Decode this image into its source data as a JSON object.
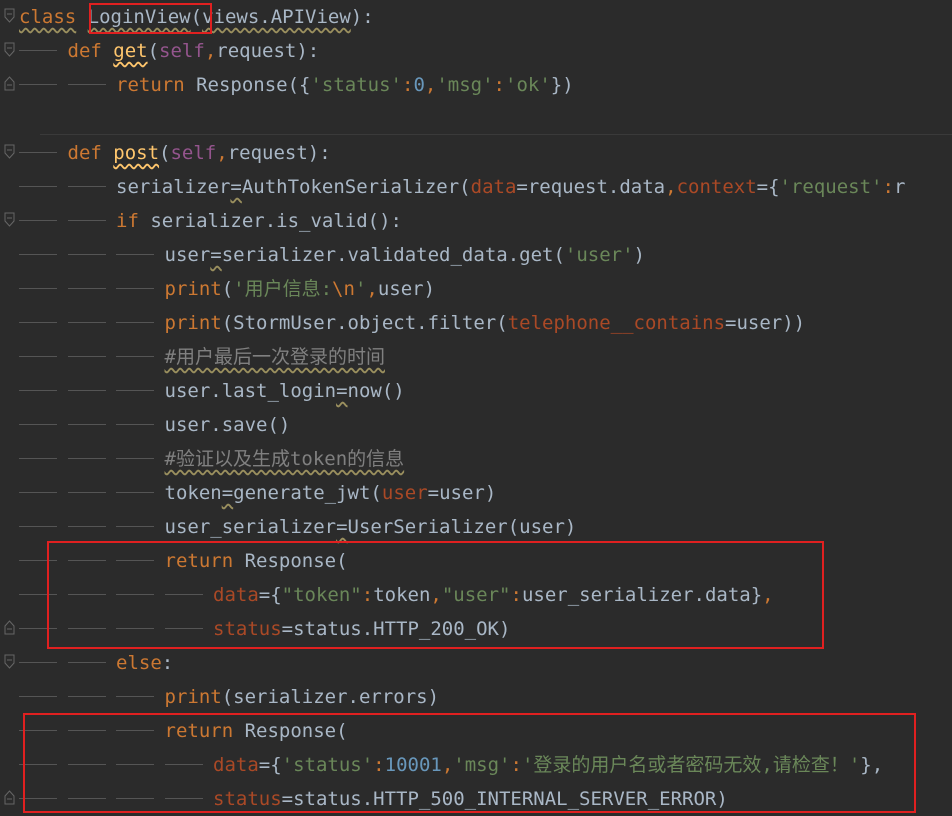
{
  "lines": [
    {
      "indent": 0,
      "fold": "start",
      "parts": [
        {
          "t": "class",
          "c": "kw warn"
        },
        {
          "t": " "
        },
        {
          "t": "LoginView",
          "c": "warn"
        },
        {
          "t": "("
        },
        {
          "t": "views.APIView",
          "c": "warn"
        },
        {
          "t": "):"
        }
      ]
    },
    {
      "indent": 1,
      "fold": "start",
      "parts": [
        {
          "t": "def ",
          "c": "kw"
        },
        {
          "t": "get",
          "c": "fn"
        },
        {
          "t": "("
        },
        {
          "t": "self",
          "c": "self"
        },
        {
          "t": ",",
          "c": "kw"
        },
        {
          "t": "request):"
        }
      ]
    },
    {
      "indent": 2,
      "fold": "end",
      "parts": [
        {
          "t": "return ",
          "c": "kw"
        },
        {
          "t": "Response({"
        },
        {
          "t": "'status'",
          "c": "str"
        },
        {
          "t": ":",
          "c": "kw"
        },
        {
          "t": "0",
          "c": "num"
        },
        {
          "t": ",",
          "c": "kw"
        },
        {
          "t": "'msg'",
          "c": "str"
        },
        {
          "t": ":",
          "c": "kw"
        },
        {
          "t": "'ok'",
          "c": "str"
        },
        {
          "t": "})"
        }
      ]
    },
    {
      "indent": 0,
      "parts": []
    },
    {
      "indent": 1,
      "fold": "start",
      "parts": [
        {
          "t": "def ",
          "c": "kw"
        },
        {
          "t": "post",
          "c": "fn"
        },
        {
          "t": "("
        },
        {
          "t": "self",
          "c": "self"
        },
        {
          "t": ",",
          "c": "kw"
        },
        {
          "t": "request):"
        }
      ]
    },
    {
      "indent": 2,
      "parts": [
        {
          "t": "serializer"
        },
        {
          "t": "=",
          "c": "warn"
        },
        {
          "t": "AuthTokenSerializer("
        },
        {
          "t": "data",
          "c": "param"
        },
        {
          "t": "=request.data"
        },
        {
          "t": ",",
          "c": "kw"
        },
        {
          "t": "context",
          "c": "param"
        },
        {
          "t": "={"
        },
        {
          "t": "'request'",
          "c": "str"
        },
        {
          "t": ":",
          "c": "kw"
        },
        {
          "t": "r"
        }
      ]
    },
    {
      "indent": 2,
      "fold": "start",
      "parts": [
        {
          "t": "if ",
          "c": "kw"
        },
        {
          "t": "serializer.is_valid():"
        }
      ]
    },
    {
      "indent": 3,
      "parts": [
        {
          "t": "user"
        },
        {
          "t": "=",
          "c": "warn"
        },
        {
          "t": "serializer.validated_data.get("
        },
        {
          "t": "'user'",
          "c": "str"
        },
        {
          "t": ")"
        }
      ]
    },
    {
      "indent": 3,
      "parts": [
        {
          "t": "print",
          "c": "kw"
        },
        {
          "t": "("
        },
        {
          "t": "'用户信息:",
          "c": "str"
        },
        {
          "t": "\\n",
          "c": "kw"
        },
        {
          "t": "'",
          "c": "str"
        },
        {
          "t": ",",
          "c": "kw"
        },
        {
          "t": "user)"
        }
      ]
    },
    {
      "indent": 3,
      "parts": [
        {
          "t": "print",
          "c": "kw"
        },
        {
          "t": "(StormUser.object.filter("
        },
        {
          "t": "telephone__contains",
          "c": "param"
        },
        {
          "t": "=user))"
        }
      ]
    },
    {
      "indent": 3,
      "parts": [
        {
          "t": "#用户最后一次登录的时间",
          "c": "cmt"
        }
      ]
    },
    {
      "indent": 3,
      "parts": [
        {
          "t": "user.last_login"
        },
        {
          "t": "=",
          "c": "warn"
        },
        {
          "t": "now()"
        }
      ]
    },
    {
      "indent": 3,
      "parts": [
        {
          "t": "user.save()"
        }
      ]
    },
    {
      "indent": 3,
      "parts": [
        {
          "t": "#验证以及生成token的信息",
          "c": "cmt"
        }
      ]
    },
    {
      "indent": 3,
      "parts": [
        {
          "t": "token"
        },
        {
          "t": "=",
          "c": "warn"
        },
        {
          "t": "generate_jwt("
        },
        {
          "t": "user",
          "c": "param"
        },
        {
          "t": "=user)"
        }
      ]
    },
    {
      "indent": 3,
      "parts": [
        {
          "t": "user_serializer"
        },
        {
          "t": "=",
          "c": "warn"
        },
        {
          "t": "UserSerializer(user)"
        }
      ]
    },
    {
      "indent": 3,
      "parts": [
        {
          "t": "return ",
          "c": "kw"
        },
        {
          "t": "Response("
        }
      ]
    },
    {
      "indent": 4,
      "parts": [
        {
          "t": "data",
          "c": "param"
        },
        {
          "t": "={"
        },
        {
          "t": "\"token\"",
          "c": "str"
        },
        {
          "t": ":",
          "c": "kw"
        },
        {
          "t": "token"
        },
        {
          "t": ",",
          "c": "kw"
        },
        {
          "t": "\"user\"",
          "c": "str"
        },
        {
          "t": ":",
          "c": "kw"
        },
        {
          "t": "user_serializer.data}"
        },
        {
          "t": ",",
          "c": "kw"
        }
      ]
    },
    {
      "indent": 4,
      "fold": "end",
      "parts": [
        {
          "t": "status",
          "c": "param"
        },
        {
          "t": "=status.HTTP_200_OK)"
        }
      ]
    },
    {
      "indent": 2,
      "fold": "start",
      "parts": [
        {
          "t": "else",
          "c": "kw"
        },
        {
          "t": ":"
        }
      ]
    },
    {
      "indent": 3,
      "parts": [
        {
          "t": "print",
          "c": "kw"
        },
        {
          "t": "(serializer.errors)"
        }
      ]
    },
    {
      "indent": 3,
      "parts": [
        {
          "t": "return ",
          "c": "kw"
        },
        {
          "t": "Response("
        }
      ]
    },
    {
      "indent": 4,
      "parts": [
        {
          "t": "data",
          "c": "param"
        },
        {
          "t": "={"
        },
        {
          "t": "'status'",
          "c": "str"
        },
        {
          "t": ":",
          "c": "kw"
        },
        {
          "t": "10001",
          "c": "num"
        },
        {
          "t": ",",
          "c": "kw"
        },
        {
          "t": "'msg'",
          "c": "str"
        },
        {
          "t": ":",
          "c": "kw"
        },
        {
          "t": "'登录的用户名或者密码无效,请检查！'",
          "c": "str"
        },
        {
          "t": "},"
        }
      ]
    },
    {
      "indent": 4,
      "fold": "end",
      "parts": [
        {
          "t": "status",
          "c": "param"
        },
        {
          "t": "=status.HTTP_500_INTERNAL_SERVER_ERROR)"
        }
      ]
    }
  ],
  "annotations": [
    "class-name-highlight",
    "success-return-highlight",
    "error-return-highlight"
  ],
  "colors": {
    "background": "#2b2b2b",
    "keyword": "#cc7832",
    "string": "#6a8759",
    "number": "#6897bb",
    "param": "#aa4926",
    "function": "#ffc66d",
    "highlight": "#e02020"
  }
}
